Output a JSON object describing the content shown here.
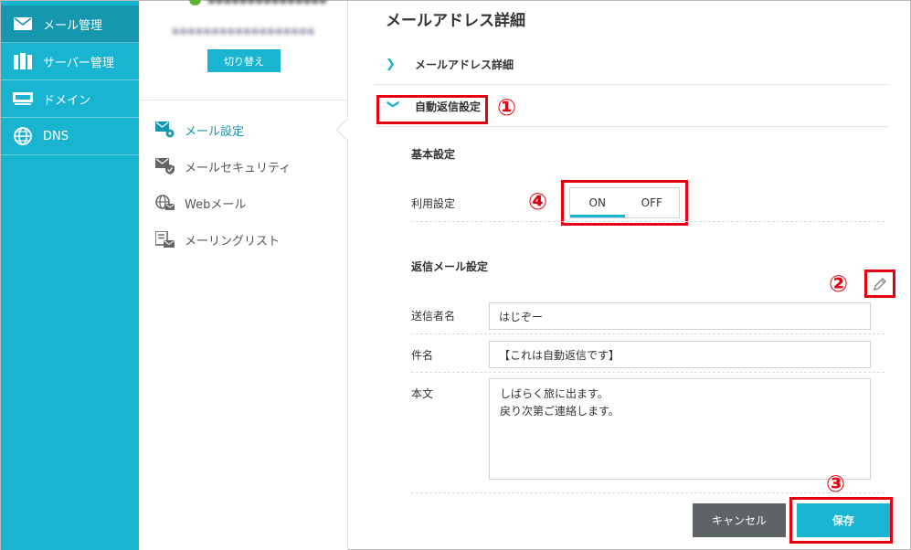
{
  "nav": {
    "items": [
      {
        "label": "メール管理",
        "icon": "mail-icon",
        "active": true
      },
      {
        "label": "サーバー管理",
        "icon": "server-icon",
        "active": false
      },
      {
        "label": "ドメイン",
        "icon": "domain-icon",
        "active": false
      },
      {
        "label": "DNS",
        "icon": "globe-icon",
        "active": false
      }
    ]
  },
  "account": {
    "switch_label": "切り替え"
  },
  "submenu": {
    "items": [
      {
        "label": "メール設定",
        "icon": "mail-settings-icon",
        "active": true
      },
      {
        "label": "メールセキュリティ",
        "icon": "mail-security-icon",
        "active": false
      },
      {
        "label": "Webメール",
        "icon": "webmail-icon",
        "active": false
      },
      {
        "label": "メーリングリスト",
        "icon": "mailing-list-icon",
        "active": false
      }
    ]
  },
  "main": {
    "title": "メールアドレス詳細",
    "accordion": [
      {
        "label": "メールアドレス詳細",
        "chevron": "chevron-right"
      },
      {
        "label": "自動返信設定",
        "chevron": "chevron-down"
      }
    ],
    "basic": {
      "title": "基本設定",
      "usage_label": "利用設定",
      "toggle_on": "ON",
      "toggle_off": "OFF",
      "selected": "ON"
    },
    "reply": {
      "title": "返信メール設定",
      "sender_label": "送信者名",
      "sender_value": "はじぞー",
      "subject_label": "件名",
      "subject_value": "【これは自動返信です】",
      "body_label": "本文",
      "body_value": "しばらく旅に出ます。\n戻り次第ご連絡します。"
    },
    "buttons": {
      "cancel": "キャンセル",
      "save": "保存"
    }
  },
  "annotations": {
    "n1": "①",
    "n2": "②",
    "n3": "③",
    "n4": "④",
    "color": "#e60012"
  },
  "colors": {
    "brand": "#18b4d0",
    "nav_active": "#1597ae",
    "cancel": "#5e6366",
    "status_online": "#5cb531"
  }
}
